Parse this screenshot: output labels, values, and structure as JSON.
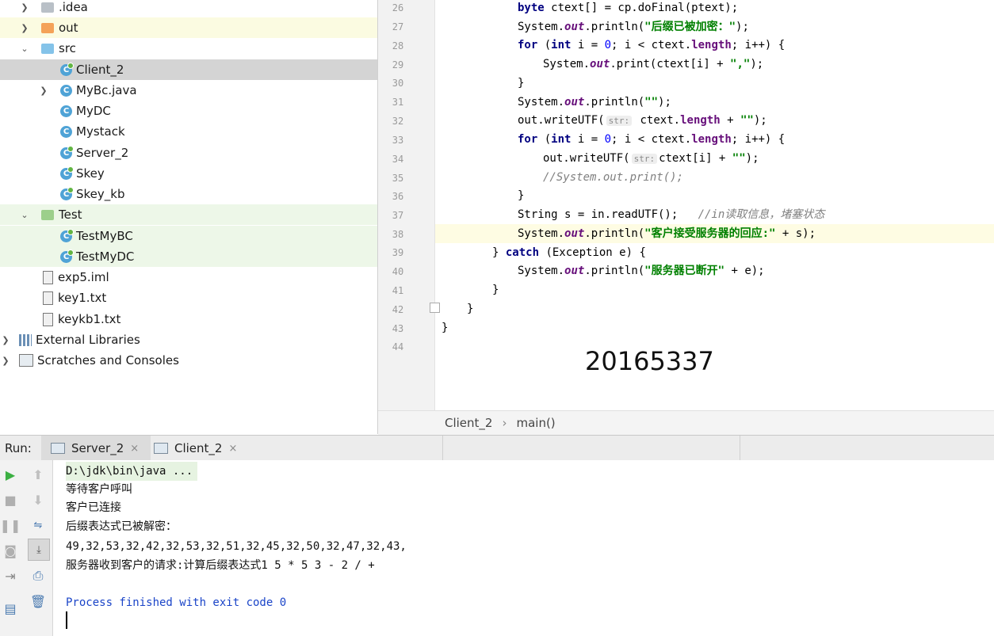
{
  "project_tree": {
    "items": [
      {
        "label": ".idea",
        "icon": "folder-icon"
      },
      {
        "label": "out",
        "icon": "folder-icon"
      },
      {
        "label": "src",
        "icon": "folder-icon"
      },
      {
        "label": "Client_2",
        "icon": "class-icon"
      },
      {
        "label": "MyBc.java",
        "icon": "class-icon"
      },
      {
        "label": "MyDC",
        "icon": "class-icon"
      },
      {
        "label": "Mystack",
        "icon": "class-icon"
      },
      {
        "label": "Server_2",
        "icon": "class-icon"
      },
      {
        "label": "Skey",
        "icon": "class-icon"
      },
      {
        "label": "Skey_kb",
        "icon": "class-icon"
      },
      {
        "label": "Test",
        "icon": "folder-icon"
      },
      {
        "label": "TestMyBC",
        "icon": "class-icon"
      },
      {
        "label": "TestMyDC",
        "icon": "class-icon"
      },
      {
        "label": "exp5.iml",
        "icon": "file-icon"
      },
      {
        "label": "key1.txt",
        "icon": "file-icon"
      },
      {
        "label": "keykb1.txt",
        "icon": "file-icon"
      },
      {
        "label": "External Libraries",
        "icon": "library-icon"
      },
      {
        "label": "Scratches and Consoles",
        "icon": "scratches-icon"
      }
    ]
  },
  "editor": {
    "line_numbers": [
      "26",
      "27",
      "28",
      "29",
      "30",
      "31",
      "32",
      "33",
      "34",
      "35",
      "36",
      "37",
      "38",
      "39",
      "40",
      "41",
      "42",
      "43",
      "44"
    ],
    "watermark": "20165337",
    "breadcrumb": {
      "class": "Client_2",
      "sep": "›",
      "method": "main()"
    },
    "tokens": {
      "byte": "byte",
      "ctext_decl": " ctext[] = cp.doFinal(ptext);",
      "system": "System.",
      "out": "out",
      "println": ".println(",
      "print": ".print(",
      "str27": "\"后缀已被加密：\"",
      "close": ");",
      "for": "for",
      "forhead1": " (",
      "int": "int",
      "forhead2": " i = ",
      "zero": "0",
      "forhead3": "; i < ctext.",
      "length": "length",
      "forhead4": "; i++) {",
      "ctexti": "ctext[i] + ",
      "comma": "\",\"",
      "brace_close": "}",
      "empty": "\"\"",
      "writeUTF": "out.writeUTF(",
      "hint": "str:",
      "ctextlen": " ctext.",
      "plus_empty": " + ",
      "comment35": "//System.out.print();",
      "line37": "String s = in.readUTF();   ",
      "comment37": "//in读取信息，堵塞状态",
      "str38": "\"客户接受服务器的回应:\"",
      "plus_s": " + s);",
      "catch_pre": "} ",
      "catch": "catch",
      "catch_post": " (Exception e) {",
      "str40": "\"服务器已断开\"",
      "plus_e": " + e);"
    }
  },
  "run_panel": {
    "label": "Run:",
    "tabs": [
      {
        "label": "Server_2",
        "close": "×"
      },
      {
        "label": "Client_2",
        "close": "×"
      }
    ],
    "output": [
      "D:\\jdk\\bin\\java ...",
      "等待客户呼叫",
      "客户已连接",
      "后缀表达式已被解密：",
      "49,32,53,32,42,32,53,32,51,32,45,32,50,32,47,32,43,",
      "服务器收到客户的请求:计算后缀表达式1 5 * 5 3 - 2 / +",
      "",
      "Process finished with exit code 0"
    ]
  },
  "colors": {
    "accent_green": "#62b543",
    "selection": "#d4d4d4",
    "link_blue": "#1a44c8"
  }
}
